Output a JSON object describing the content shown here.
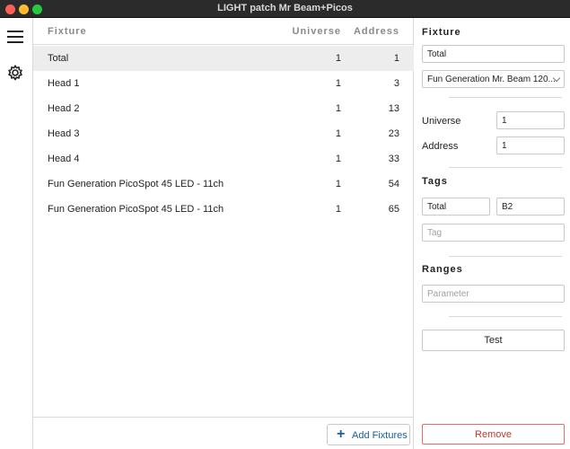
{
  "window": {
    "title": "LIGHT patch Mr Beam+Picos"
  },
  "table": {
    "headers": {
      "fixture": "Fixture",
      "universe": "Universe",
      "address": "Address"
    },
    "rows": [
      {
        "name": "Total",
        "universe": "1",
        "address": "1",
        "selected": true
      },
      {
        "name": "Head 1",
        "universe": "1",
        "address": "3"
      },
      {
        "name": "Head 2",
        "universe": "1",
        "address": "13"
      },
      {
        "name": "Head 3",
        "universe": "1",
        "address": "23"
      },
      {
        "name": "Head 4",
        "universe": "1",
        "address": "33"
      },
      {
        "name": "Fun Generation PicoSpot 45 LED - 11ch",
        "universe": "1",
        "address": "54"
      },
      {
        "name": "Fun Generation PicoSpot 45 LED - 11ch",
        "universe": "1",
        "address": "65"
      }
    ]
  },
  "footer": {
    "add_label": "Add Fixtures"
  },
  "side": {
    "fixture_heading": "Fixture",
    "fixture_name": "Total",
    "fixture_type": "Fun Generation Mr. Beam 120...",
    "universe_label": "Universe",
    "universe_value": "1",
    "address_label": "Address",
    "address_value": "1",
    "tags_heading": "Tags",
    "tags": [
      "Total",
      "B2"
    ],
    "tag_placeholder": "Tag",
    "ranges_heading": "Ranges",
    "parameter_placeholder": "Parameter",
    "test_label": "Test",
    "remove_label": "Remove"
  },
  "icons": {
    "menu": "hamburger-menu-icon",
    "settings": "gear-icon",
    "add": "plus-icon",
    "dropdown": "chevron-down-icon"
  },
  "colors": {
    "accent": "#1a5e9a",
    "danger": "#c0392b",
    "selected_row": "#ededed"
  }
}
